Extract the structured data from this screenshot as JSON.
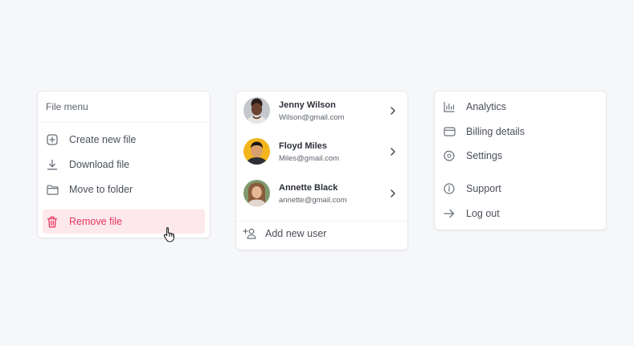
{
  "file_menu": {
    "title": "File menu",
    "items": [
      {
        "label": "Create new file",
        "icon": "plus-square-icon"
      },
      {
        "label": "Download file",
        "icon": "download-icon"
      },
      {
        "label": "Move to folder",
        "icon": "folder-icon"
      },
      {
        "label": "Remove file",
        "icon": "trash-icon",
        "state": "hover",
        "color": "#e8365d"
      }
    ]
  },
  "users": {
    "items": [
      {
        "name": "Jenny Wilson",
        "email": "Wilson@gmail.com"
      },
      {
        "name": "Floyd Miles",
        "email": "Miles@gmail.com"
      },
      {
        "name": "Annette Black",
        "email": "annette@gmail.com"
      }
    ],
    "add_label": "Add new user"
  },
  "account_menu": {
    "items": [
      {
        "label": "Analytics",
        "icon": "bar-chart-icon"
      },
      {
        "label": "Billing details",
        "icon": "credit-card-icon"
      },
      {
        "label": "Settings",
        "icon": "gear-icon"
      },
      {
        "label": "Support",
        "icon": "info-icon"
      },
      {
        "label": "Log out",
        "icon": "arrow-right-icon"
      }
    ]
  },
  "colors": {
    "background": "#f6f7f9",
    "danger": "#e8365d",
    "danger_bg": "#fde8ec",
    "text": "#4a4f58"
  }
}
